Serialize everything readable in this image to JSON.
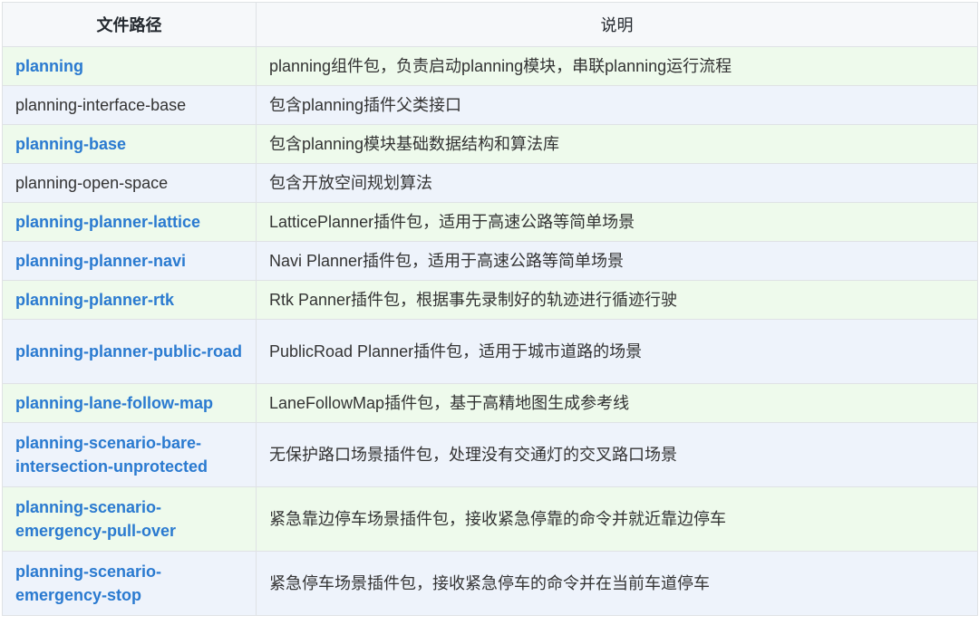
{
  "header": {
    "col_path": "文件路径",
    "col_desc": "说明"
  },
  "rows": [
    {
      "path": "planning",
      "desc": "planning组件包，负责启动planning模块，串联planning运行流程"
    },
    {
      "path": "planning-interface-base",
      "desc": "包含planning插件父类接口"
    },
    {
      "path": "planning-base",
      "desc": "包含planning模块基础数据结构和算法库"
    },
    {
      "path": "planning-open-space",
      "desc": "包含开放空间规划算法"
    },
    {
      "path": "planning-planner-lattice",
      "desc": "LatticePlanner插件包，适用于高速公路等简单场景"
    },
    {
      "path": "planning-planner-navi",
      "desc": "Navi Planner插件包，适用于高速公路等简单场景"
    },
    {
      "path": "planning-planner-rtk",
      "desc": "Rtk Panner插件包，根据事先录制好的轨迹进行循迹行驶"
    },
    {
      "path": "planning-planner-public-road",
      "desc": "PublicRoad Planner插件包，适用于城市道路的场景"
    },
    {
      "path": "planning-lane-follow-map",
      "desc": "LaneFollowMap插件包，基于高精地图生成参考线"
    },
    {
      "path": "planning-scenario-bare-intersection-unprotected",
      "desc": "无保护路口场景插件包，处理没有交通灯的交叉路口场景"
    },
    {
      "path": "planning-scenario-emergency-pull-over",
      "desc": "紧急靠边停车场景插件包，接收紧急停靠的命令并就近靠边停车"
    },
    {
      "path": "planning-scenario-emergency-stop",
      "desc": "紧急停车场景插件包，接收紧急停车的命令并在当前车道停车"
    }
  ]
}
